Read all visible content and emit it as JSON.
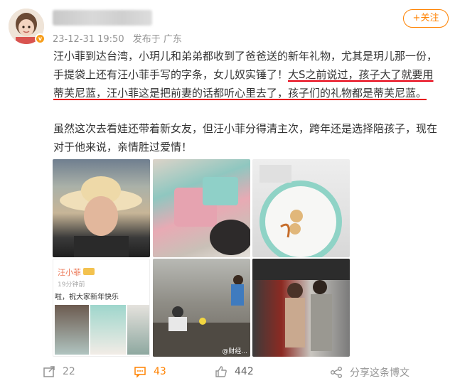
{
  "post": {
    "timestamp": "23-12-31 19:50",
    "source": "发布于 广东",
    "follow_label": "+关注",
    "paragraph1": {
      "l1": "汪小菲到达台湾，小玥儿和弟弟都收到了爸爸送的新年礼物，尤其是玥儿那一份，",
      "l2a": "手提袋上还有汪小菲手写的字条，女儿奴实锤了！",
      "l2b": "大S之前说过，孩子大了就要用",
      "l3": "蒂芙尼蓝，汪小菲这是把前妻的话都听心里去了，孩子们的礼物都是蒂芙尼蓝。"
    },
    "paragraph2": {
      "l1": "虽然这次去看娃还带着新女友，但汪小菲分得清主次，跨年还是选择陪孩子，现在",
      "l2": "对于他来说，亲情胜过爱情！"
    },
    "embedded_screenshot": {
      "name": "汪小菲",
      "sub": "19分钟前",
      "caption": "啦，祝大家新年快乐"
    },
    "watermark": "@财经..."
  },
  "footer": {
    "reposts": "22",
    "comments": "43",
    "likes": "442",
    "share_label": "分享这条博文"
  },
  "colors": {
    "accent": "#ff8200",
    "underline": "#e60012"
  },
  "icons": [
    "avatar",
    "verified-badge-icon",
    "repost-icon",
    "comment-icon",
    "like-icon",
    "share-icon"
  ]
}
